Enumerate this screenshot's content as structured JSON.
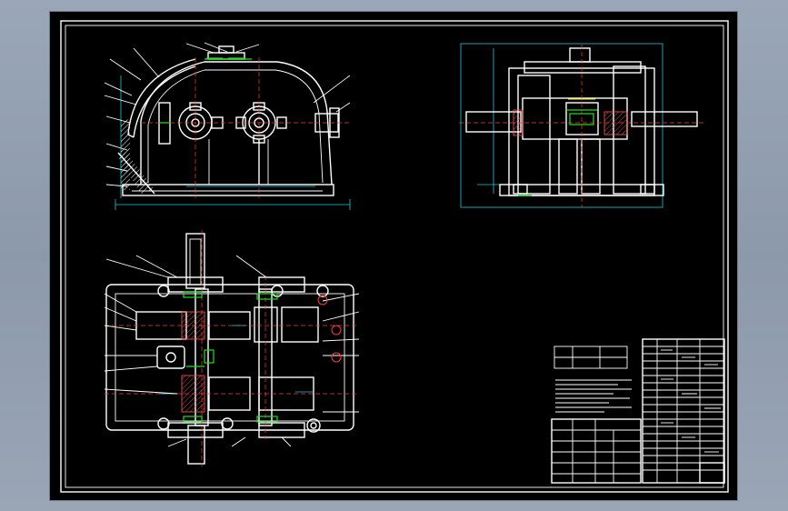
{
  "drawing": {
    "views": [
      {
        "name": "front-view"
      },
      {
        "name": "side-view"
      },
      {
        "name": "top-view"
      }
    ]
  }
}
